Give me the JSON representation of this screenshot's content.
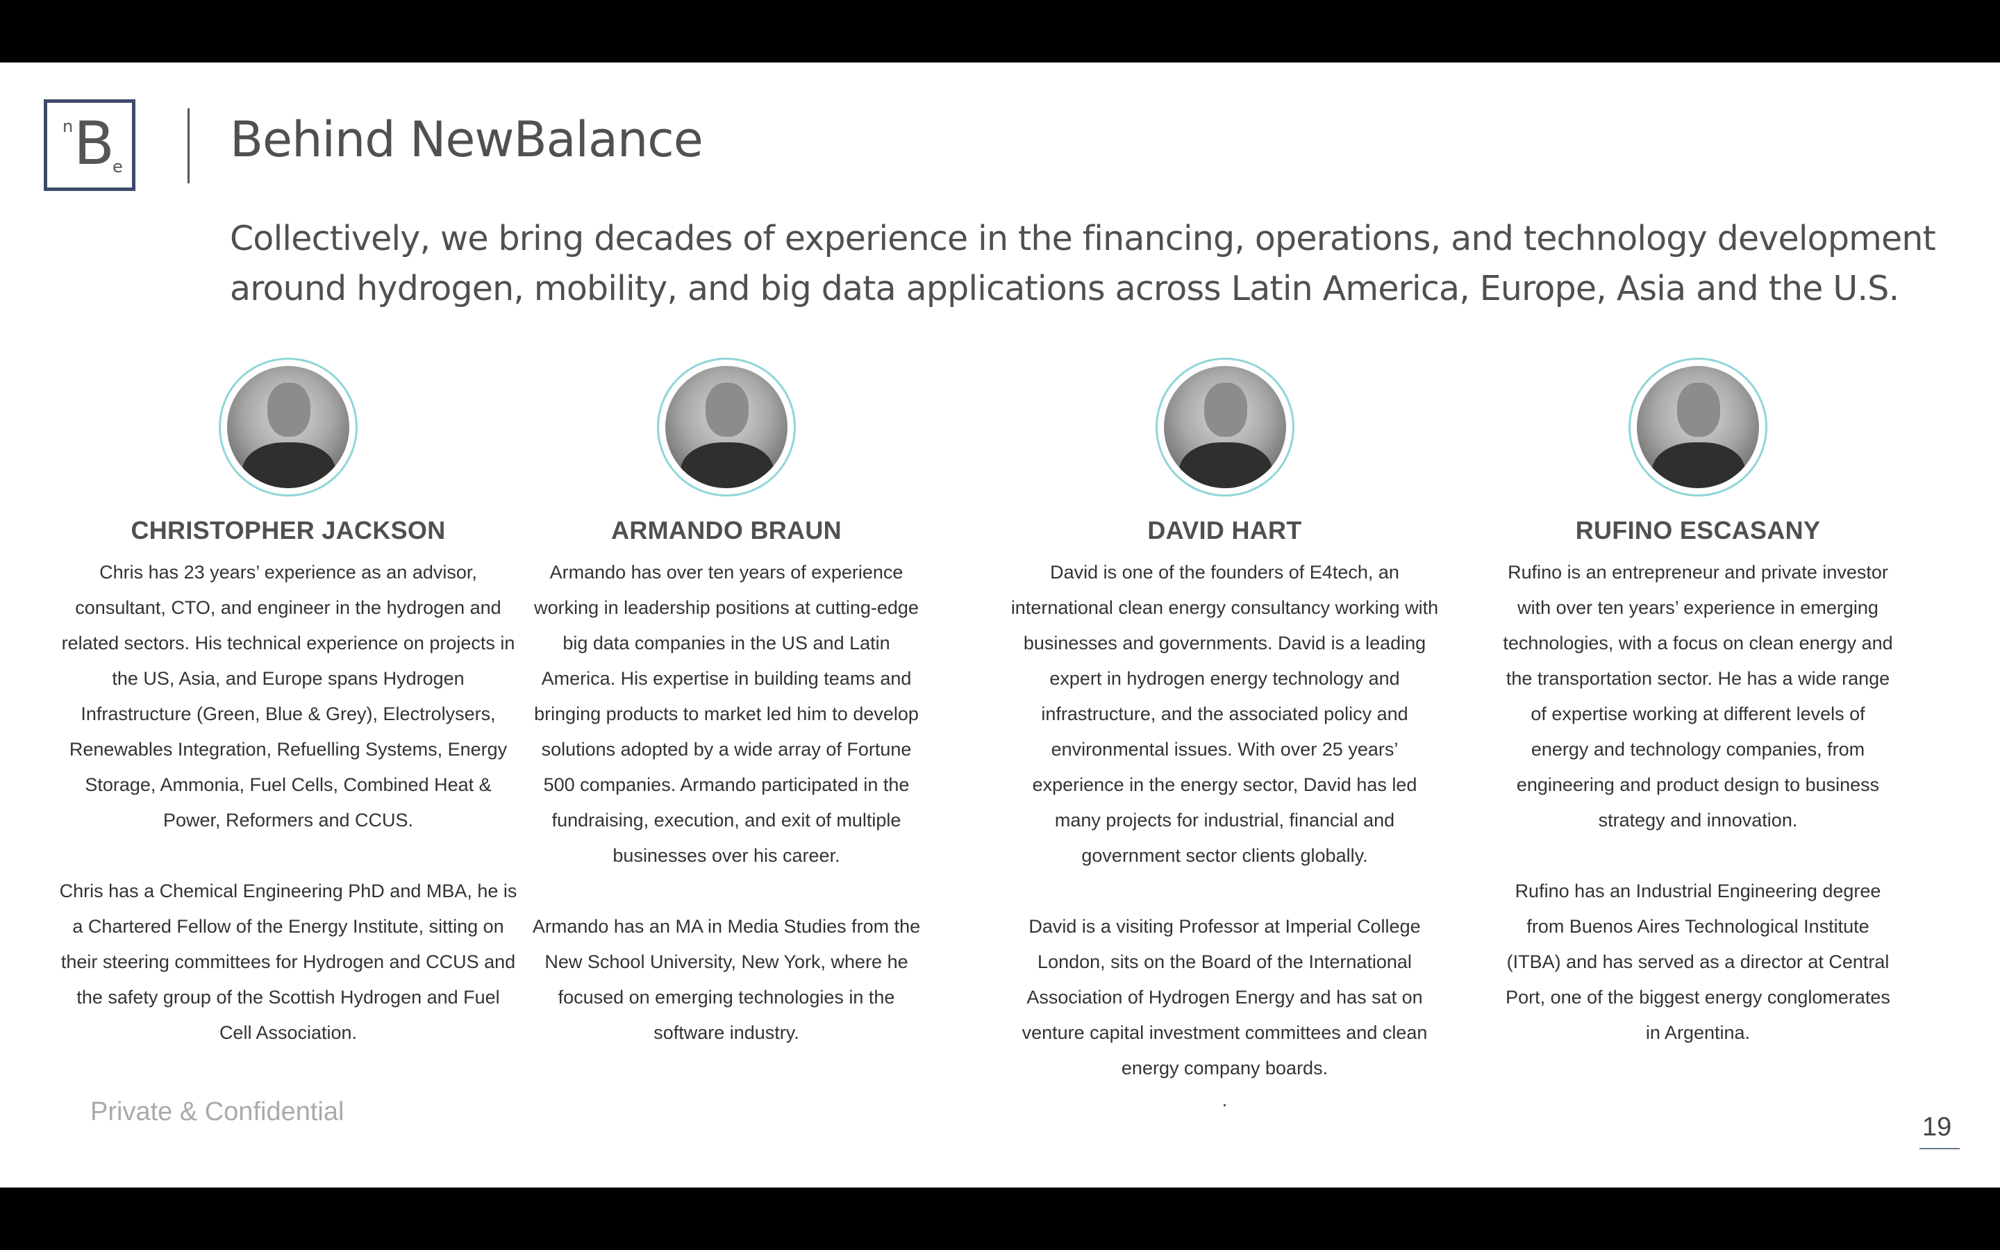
{
  "header": {
    "logo_letters": {
      "n": "n",
      "b": "B",
      "e": "e"
    },
    "title": "Behind NewBalance",
    "subtitle": "Collectively, we bring decades of experience in the financing, operations, and technology development around hydrogen, mobility, and big data applications across Latin America, Europe, Asia and the U.S."
  },
  "people": [
    {
      "name": "CHRISTOPHER JACKSON",
      "bio": [
        "Chris has 23 years’ experience as an advisor, consultant, CTO, and engineer in the hydrogen and related sectors.  His technical experience on projects in the US, Asia, and Europe spans Hydrogen Infrastructure (Green, Blue & Grey), Electrolysers, Renewables Integration, Refuelling Systems, Energy Storage, Ammonia, Fuel Cells, Combined Heat & Power, Reformers and CCUS.",
        "Chris has a Chemical Engineering PhD and MBA, he is a Chartered Fellow of the Energy Institute, sitting on their steering committees for Hydrogen and CCUS and the safety group of the Scottish Hydrogen and Fuel Cell Association."
      ]
    },
    {
      "name": "ARMANDO BRAUN",
      "bio": [
        "Armando has over ten years of experience working in leadership positions at cutting-edge big data companies in the US and Latin America. His expertise in building teams and bringing products to market led him to develop solutions adopted by a wide array of Fortune 500 companies. Armando participated in the fundraising, execution, and exit of multiple businesses over his career.",
        "Armando has an MA in Media Studies from the New School University, New York, where he focused on emerging technologies in the software industry."
      ]
    },
    {
      "name": "DAVID HART",
      "bio": [
        "David is one of the founders of E4tech, an international clean energy consultancy working with businesses and governments. David is a leading expert in hydrogen energy technology and infrastructure, and the associated policy and environmental issues.  With over 25 years’ experience in the energy sector, David has led many projects for industrial, financial and government sector clients globally.",
        "David is a visiting Professor at Imperial College London, sits on the Board of the International Association of Hydrogen Energy and has sat on venture capital investment committees and clean energy company boards."
      ],
      "trailing": "."
    },
    {
      "name": "RUFINO ESCASANY",
      "bio": [
        "Rufino is an entrepreneur and private investor with over ten years’ experience in emerging technologies, with a focus on clean energy and the transportation sector. He has a  wide range of expertise working at different levels of energy and technology companies, from engineering and product design to business strategy and innovation.",
        "Rufino has an Industrial Engineering degree from Buenos Aires Technological Institute (ITBA) and has served as a director at Central Port, one of the biggest energy conglomerates in Argentina."
      ]
    }
  ],
  "footer": {
    "confidential": "Private & Confidential",
    "page_number": "19"
  },
  "colors": {
    "logo_border": "#3f4a6a",
    "photo_ring": "#8fd6d8",
    "text": "#505050"
  }
}
